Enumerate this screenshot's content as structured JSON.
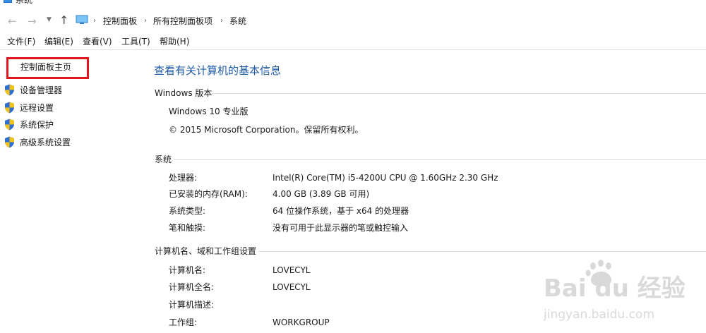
{
  "window": {
    "title": "系统"
  },
  "address_bar": {
    "breadcrumbs": [
      "控制面板",
      "所有控制面板项",
      "系统"
    ]
  },
  "menu": [
    "文件(F)",
    "编辑(E)",
    "查看(V)",
    "工具(T)",
    "帮助(H)"
  ],
  "sidebar": {
    "home_link": "控制面板主页",
    "items": [
      {
        "label": "设备管理器",
        "icon": "shield-icon"
      },
      {
        "label": "远程设置",
        "icon": "shield-icon"
      },
      {
        "label": "系统保护",
        "icon": "shield-icon"
      },
      {
        "label": "高级系统设置",
        "icon": "shield-icon"
      }
    ],
    "highlight_color": "#e0161c"
  },
  "main": {
    "title": "查看有关计算机的基本信息",
    "edition": {
      "heading": "Windows 版本",
      "name": "Windows 10 专业版",
      "copyright": "© 2015 Microsoft Corporation。保留所有权利。"
    },
    "system": {
      "heading": "系统",
      "rows": [
        {
          "label": "处理器:",
          "value": "Intel(R) Core(TM) i5-4200U CPU @ 1.60GHz   2.30 GHz"
        },
        {
          "label": "已安装的内存(RAM):",
          "value": "4.00 GB (3.89 GB 可用)"
        },
        {
          "label": "系统类型:",
          "value": "64 位操作系统，基于 x64 的处理器"
        },
        {
          "label": "笔和触摸:",
          "value": "没有可用于此显示器的笔或触控输入"
        }
      ]
    },
    "computer": {
      "heading": "计算机名、域和工作组设置",
      "rows": [
        {
          "label": "计算机名:",
          "value": "LOVECYL"
        },
        {
          "label": "计算机全名:",
          "value": "LOVECYL"
        },
        {
          "label": "计算机描述:",
          "value": ""
        },
        {
          "label": "工作组:",
          "value": "WORKGROUP"
        }
      ]
    }
  },
  "watermark": {
    "brand": "Bai du 经验",
    "url": "jingyan.baidu.com"
  },
  "colors": {
    "link_title": "#1e5aa8",
    "shield_blue": "#2b6fd6",
    "shield_yellow": "#f2c31b"
  }
}
